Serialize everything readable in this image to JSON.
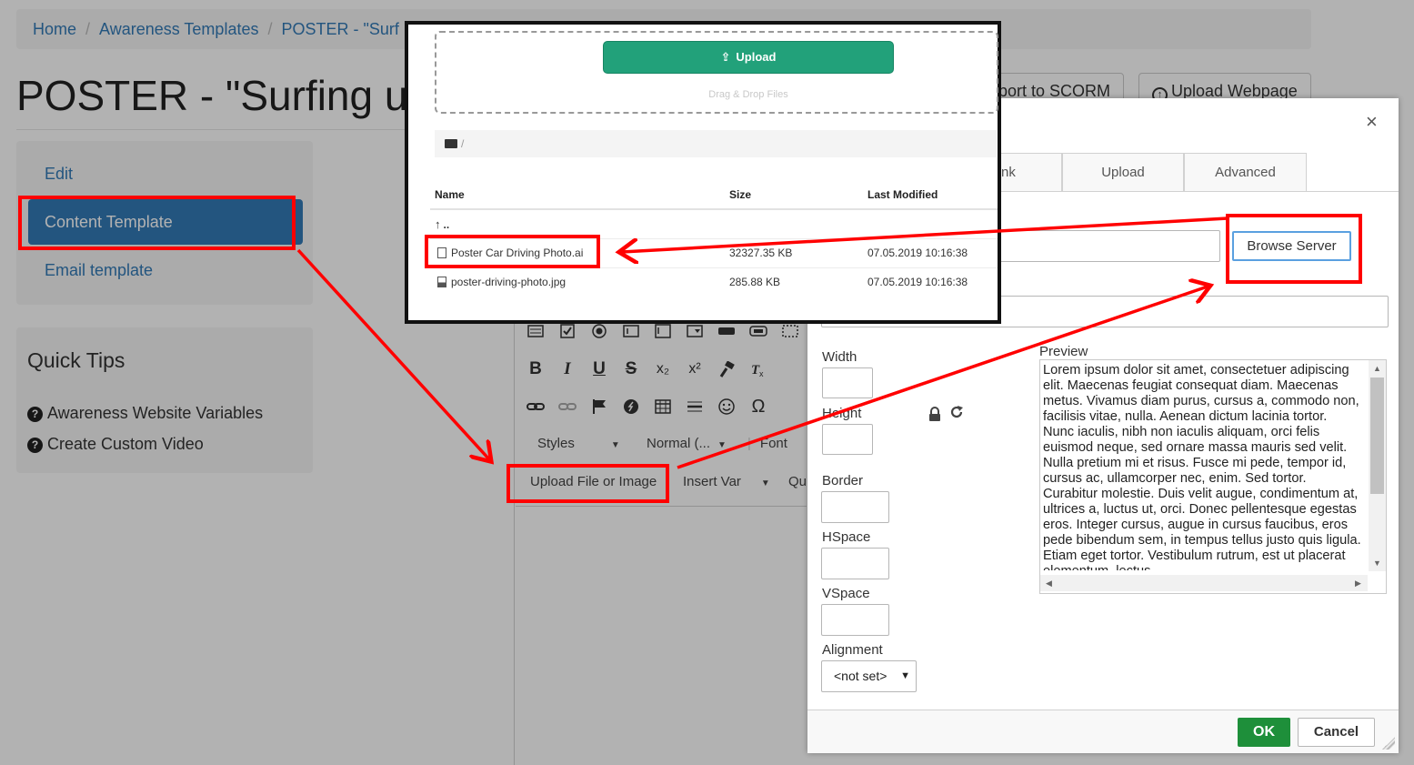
{
  "breadcrumb": {
    "items": [
      "Home",
      "Awareness Templates",
      "POSTER - \"Surf"
    ],
    "separator": "/"
  },
  "page": {
    "title": "POSTER - \"Surfing u"
  },
  "header_buttons": {
    "export_scorm": "port to SCORM",
    "upload_webpage": "Upload Webpage",
    "upload_icon": "circle-up-arrow-icon"
  },
  "nav": {
    "items": [
      "Edit",
      "Content Template",
      "Email template"
    ],
    "active": "Content Template"
  },
  "quick_tips": {
    "title": "Quick Tips",
    "items": [
      "Awareness Website Variables",
      "Create Custom Video"
    ],
    "icon": "question-circle-icon"
  },
  "editor": {
    "styles_label": "Styles",
    "format_label": "Normal (...",
    "font_label": "Font",
    "upload_file_label": "Upload File or Image",
    "insert_var_label": "Insert Var",
    "quick_label": "Qu",
    "toolbar_symbols": {
      "bold": "B",
      "italic": "I",
      "underline": "U",
      "strike": "S",
      "subscript": "x₂",
      "superscript": "x²",
      "omega": "Ω"
    }
  },
  "dialog": {
    "close_glyph": "×",
    "tabs": [
      "nk",
      "Upload",
      "Advanced"
    ],
    "browse_server_label": "Browse Server",
    "labels": {
      "width": "Width",
      "height": "Height",
      "border": "Border",
      "hspace": "HSpace",
      "vspace": "VSpace",
      "alignment": "Alignment",
      "preview": "Preview"
    },
    "alignment_value": "<not set>",
    "preview_text": "Lorem ipsum dolor sit amet, consectetuer adipiscing elit. Maecenas feugiat consequat diam. Maecenas metus. Vivamus diam purus, cursus a, commodo non, facilisis vitae, nulla. Aenean dictum lacinia tortor. Nunc iaculis, nibh non iaculis aliquam, orci felis euismod neque, sed ornare massa mauris sed velit. Nulla pretium mi et risus. Fusce mi pede, tempor id, cursus ac, ullamcorper nec, enim. Sed tortor. Curabitur molestie. Duis velit augue, condimentum at, ultrices a, luctus ut, orci. Donec pellentesque egestas eros. Integer cursus, augue in cursus faucibus, eros pede bibendum sem, in tempus tellus justo quis ligula. Etiam eget tortor. Vestibulum rutrum, est ut placerat elementum, lectus",
    "ok_label": "OK",
    "cancel_label": "Cancel"
  },
  "file_browser": {
    "upload_label": "Upload",
    "drag_drop_text": "Drag & Drop Files",
    "path": "/",
    "columns": [
      "Name",
      "Size",
      "Last Modified"
    ],
    "parent_label": "..",
    "files": [
      {
        "name": "Poster Car Driving Photo.ai",
        "size": "32327.35 KB",
        "modified": "07.05.2019 10:16:38"
      },
      {
        "name": "poster-driving-photo.jpg",
        "size": "285.88 KB",
        "modified": "07.05.2019 10:16:38"
      }
    ]
  },
  "colors": {
    "primary": "#337ab7",
    "upload_green": "#22a17a",
    "ok_green": "#1e8f3a",
    "annotation_red": "#ff0000"
  }
}
